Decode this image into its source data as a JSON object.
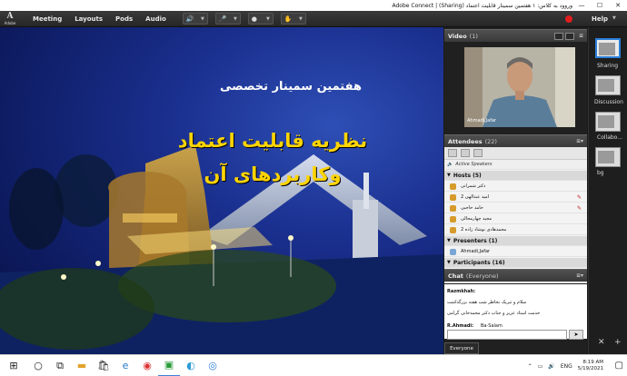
{
  "window": {
    "title": "وروود به کلاس: ۱ هفتمین سمینار قابلیت اعتماد (Sharing) | Adobe Connect"
  },
  "menubar": {
    "logo_letter": "A",
    "logo_sub": "Adobe",
    "items": [
      "Meeting",
      "Layouts",
      "Pods",
      "Audio"
    ],
    "help_label": "Help"
  },
  "slide": {
    "line1": "هفتمین سمینار تخصصی",
    "line2": "نظریه قابلیت اعتماد",
    "line3": "وکاربردهای آن"
  },
  "video_pod": {
    "title": "Video",
    "count": "(1)",
    "participant_name": "Ahmadi,Jafar"
  },
  "attendees_pod": {
    "title": "Attendees",
    "count": "(22)",
    "active_speakers_label": "Active Speakers",
    "hosts_label": "Hosts (5)",
    "hosts": [
      "دکتر شمرانی",
      "امید عبدالهی 2",
      "حامد حاجبی",
      "مجید چهارمحالی",
      "محمدهادی نوشاد زاده 2"
    ],
    "presenters_label": "Presenters (1)",
    "presenters": [
      "Ahmadi,Jafar"
    ],
    "participants_label": "Participants (16)"
  },
  "chat_pod": {
    "title": "Chat",
    "scope": "(Everyone)",
    "messages": [
      {
        "sender": "Razmkhah:",
        "text": ""
      },
      {
        "sender": "",
        "text": "سلام و تبریک بخاطر شب هفته بزرگداشت"
      },
      {
        "sender": "",
        "text": "خدمت استاد عزیز و جناب دکتر محمدخانی گرامی"
      },
      {
        "sender": "R.Ahmadi:",
        "text": "Ba-Salam"
      }
    ],
    "tab_label": "Everyone"
  },
  "layouts": {
    "items": [
      "Sharing",
      "Discussion",
      "Collabo...",
      "bg"
    ]
  },
  "taskbar": {
    "lang": "ENG",
    "time": "8:19 AM",
    "date": "5/19/2021"
  },
  "colors": {
    "record": "#e01e1e",
    "accent": "#2c7fd8",
    "slide_yellow": "#ffd400"
  }
}
